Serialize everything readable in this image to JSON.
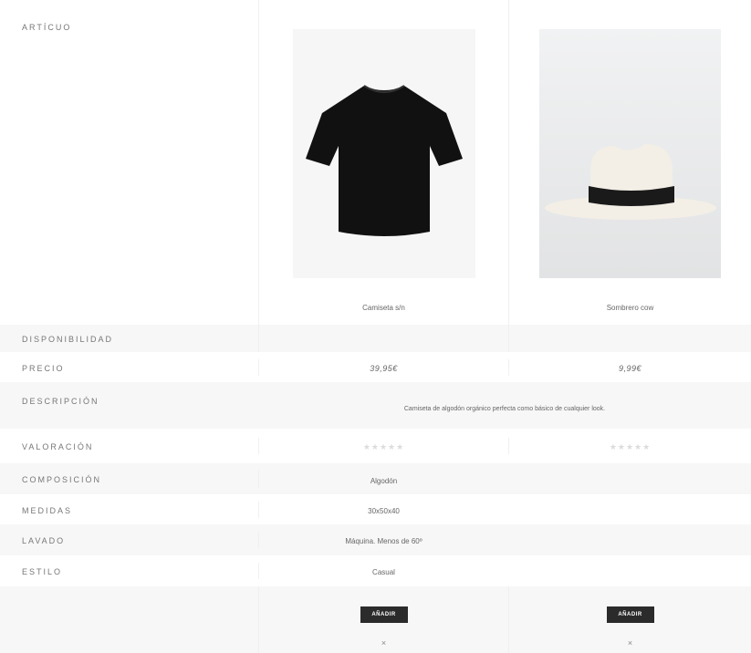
{
  "labels": {
    "item": "ARTÍCUO",
    "availability": "DISPONIBILIDAD",
    "price": "PRECIO",
    "description": "DESCRIPCIÓN",
    "rating": "VALORACIÓN",
    "composition": "COMPOSICIÓN",
    "measures": "MEDIDAS",
    "washing": "LAVADO",
    "style": "ESTILO"
  },
  "products": [
    {
      "name": "Camiseta s/n",
      "image_icon": "black-tshirt-image",
      "price": "39,95€",
      "description": "Camiseta de algodón orgánico perfecta como básico de cualquier look.",
      "rating": "★★★★★",
      "composition": "Algodón",
      "measures": "30x50x40",
      "washing": "Máquina. Menos de 60º",
      "style": "Casual",
      "add_label": "AÑADIR",
      "remove_label": "×"
    },
    {
      "name": "Sombrero cow",
      "image_icon": "white-hat-image",
      "price": "9,99€",
      "rating": "★★★★★",
      "add_label": "AÑADIR",
      "remove_label": "×"
    }
  ],
  "colors": {
    "button": "#2b2b2b",
    "row_alt": "#f7f7f7",
    "tshirt": "#111111",
    "hat": "#f3efe6",
    "hat_band": "#1a1a1a"
  }
}
